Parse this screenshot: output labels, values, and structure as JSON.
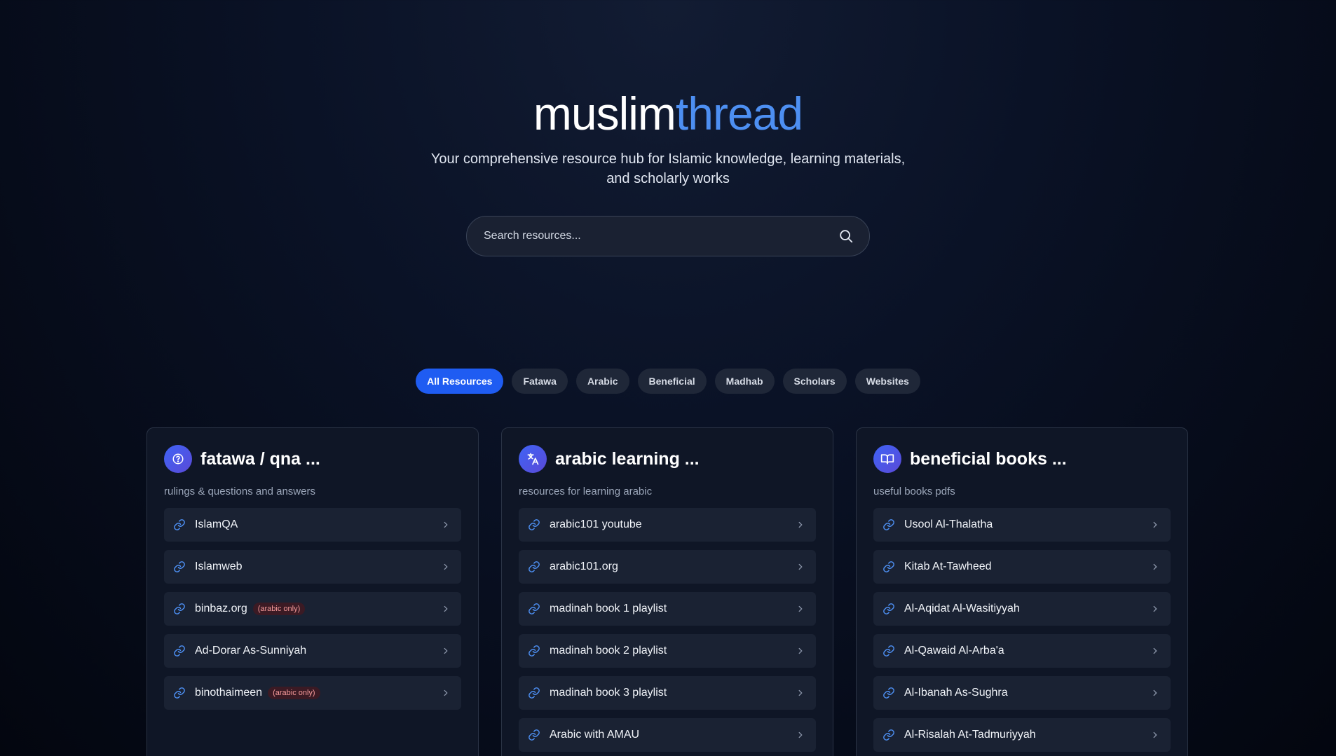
{
  "brand": {
    "part1": "muslim",
    "part2": "thread"
  },
  "tagline": "Your comprehensive resource hub for Islamic knowledge, learning materials, and scholarly works",
  "search": {
    "placeholder": "Search resources...",
    "icon": "search-icon"
  },
  "filters": [
    {
      "label": "All Resources",
      "active": true
    },
    {
      "label": "Fatawa",
      "active": false
    },
    {
      "label": "Arabic",
      "active": false
    },
    {
      "label": "Beneficial",
      "active": false
    },
    {
      "label": "Madhab",
      "active": false
    },
    {
      "label": "Scholars",
      "active": false
    },
    {
      "label": "Websites",
      "active": false
    }
  ],
  "cards": [
    {
      "icon": "question-circle-icon",
      "title": "fatawa / qna ...",
      "subtitle": "rulings & questions and answers",
      "items": [
        {
          "label": "IslamQA",
          "badge": ""
        },
        {
          "label": "Islamweb",
          "badge": ""
        },
        {
          "label": "binbaz.org",
          "badge": "(arabic only)"
        },
        {
          "label": "Ad-Dorar As-Sunniyah",
          "badge": ""
        },
        {
          "label": "binothaimeen",
          "badge": "(arabic only)"
        }
      ]
    },
    {
      "icon": "translate-icon",
      "title": "arabic learning ...",
      "subtitle": "resources for learning arabic",
      "items": [
        {
          "label": "arabic101 youtube",
          "badge": ""
        },
        {
          "label": "arabic101.org",
          "badge": ""
        },
        {
          "label": "madinah book 1 playlist",
          "badge": ""
        },
        {
          "label": "madinah book 2 playlist",
          "badge": ""
        },
        {
          "label": "madinah book 3 playlist",
          "badge": ""
        },
        {
          "label": "Arabic with AMAU",
          "badge": ""
        }
      ]
    },
    {
      "icon": "open-book-icon",
      "title": "beneficial books ...",
      "subtitle": "useful books pdfs",
      "items": [
        {
          "label": "Usool Al-Thalatha",
          "badge": ""
        },
        {
          "label": "Kitab At-Tawheed",
          "badge": ""
        },
        {
          "label": "Al-Aqidat Al-Wasitiyyah",
          "badge": ""
        },
        {
          "label": "Al-Qawaid Al-Arba'a",
          "badge": ""
        },
        {
          "label": "Al-Ibanah As-Sughra",
          "badge": ""
        },
        {
          "label": "Al-Risalah At-Tadmuriyyah",
          "badge": ""
        }
      ]
    }
  ],
  "colors": {
    "accent": "#4d8ff2",
    "active_chip": "#1f5cf2",
    "badge_text": "#f59a9a"
  }
}
